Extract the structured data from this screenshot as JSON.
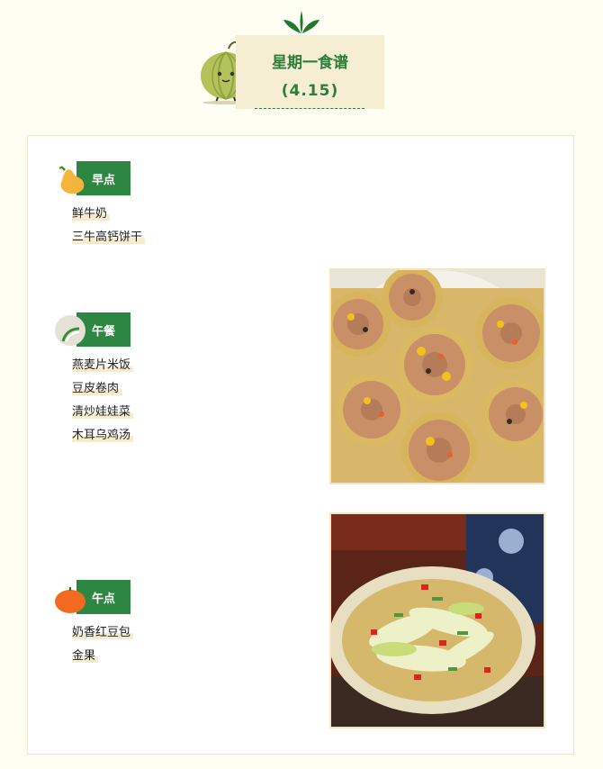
{
  "header": {
    "title": "星期一食谱",
    "date": "(4.15)"
  },
  "sections": [
    {
      "label": "早点",
      "icon": "pear-icon",
      "items": [
        "鲜牛奶",
        "三牛高钙饼干"
      ]
    },
    {
      "label": "午餐",
      "icon": "mushroom-icon",
      "items": [
        "燕麦片米饭",
        "豆皮卷肉",
        "清炒娃娃菜",
        "木耳乌鸡汤"
      ]
    },
    {
      "label": "午点",
      "icon": "pumpkin-icon",
      "items": [
        "奶香红豆包",
        "金果"
      ]
    }
  ],
  "photos": [
    {
      "name": "bean-curd-roll-photo"
    },
    {
      "name": "stir-fried-cabbage-photo"
    }
  ],
  "colors": {
    "accent_green": "#2d8642",
    "title_bg": "#f5eed2",
    "page_bg": "#fefef3"
  }
}
